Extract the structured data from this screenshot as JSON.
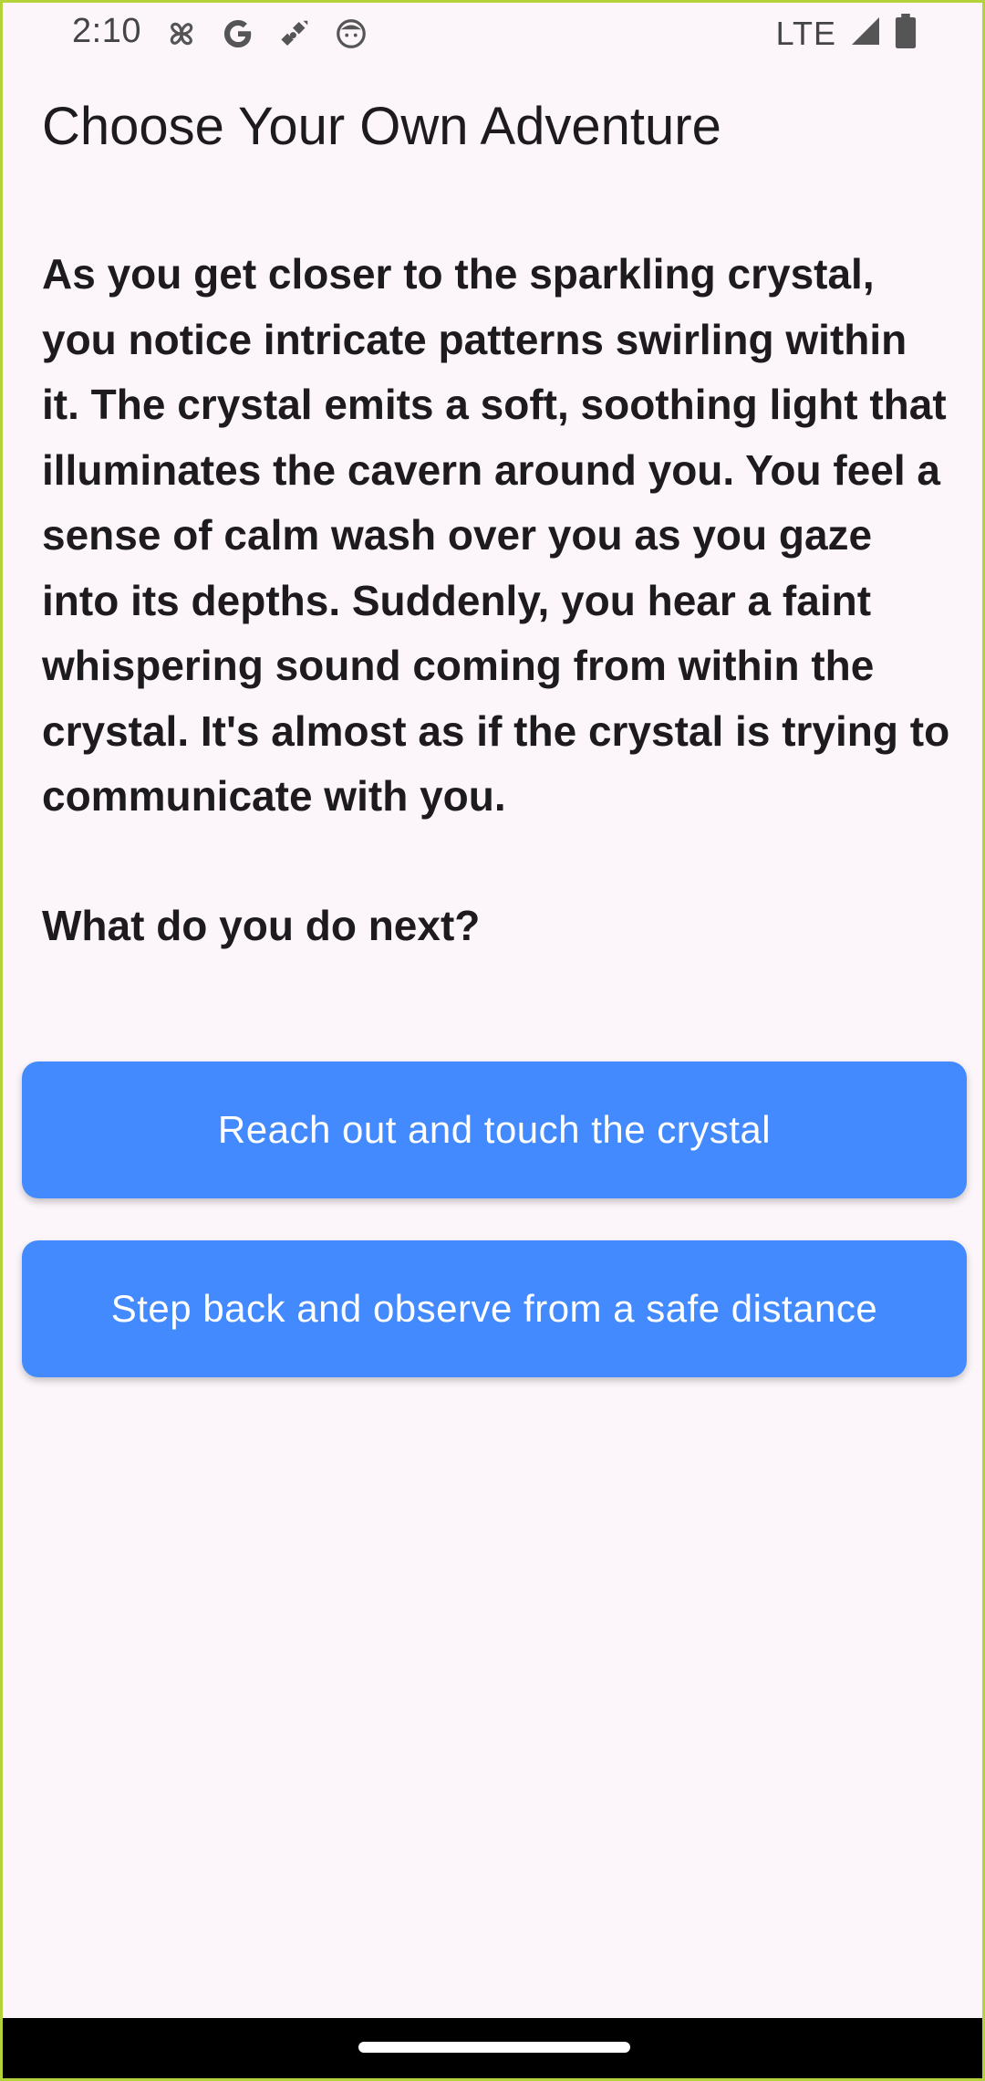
{
  "status_bar": {
    "time": "2:10",
    "network": "LTE",
    "icons_left": [
      "pinwheel-icon",
      "google-icon",
      "satellite-icon",
      "face-icon"
    ],
    "icons_right": [
      "signal-icon",
      "battery-icon"
    ]
  },
  "app": {
    "title": "Choose Your Own Adventure"
  },
  "story": {
    "text": "As you get closer to the sparkling crystal, you notice intricate patterns swirling within it. The crystal emits a soft, soothing light that illuminates the cavern around you. You feel a sense of calm wash over you as you gaze into its depths. Suddenly, you hear a faint whispering sound coming from within the crystal. It's almost as if the crystal is trying to communicate with you.",
    "prompt": "What do you do next?"
  },
  "choices": [
    {
      "label": "Reach out and touch the crystal"
    },
    {
      "label": "Step back and observe from a safe distance"
    }
  ],
  "colors": {
    "background": "#fcf6fb",
    "button": "#448aff",
    "button_text": "#ffffff",
    "text": "#1d1b1e",
    "frame_border": "#b4d33a"
  }
}
